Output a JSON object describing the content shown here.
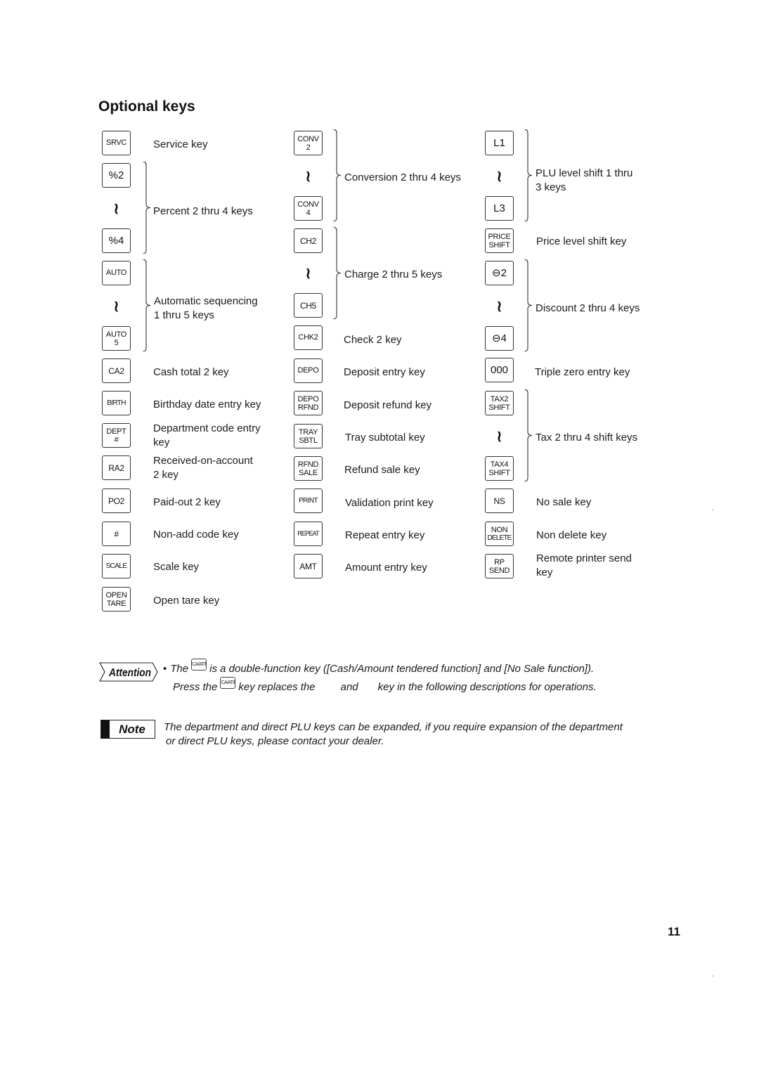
{
  "section_title": "Optional keys",
  "columns": [
    {
      "entries": [
        {
          "type": "single",
          "key": {
            "lines": [
              "SRVC"
            ]
          },
          "description": "Service key"
        },
        {
          "type": "range",
          "first": {
            "lines": [
              "%2"
            ]
          },
          "last": {
            "lines": [
              "%4"
            ]
          },
          "description": "Percent 2 thru 4 keys"
        },
        {
          "type": "range",
          "first": {
            "lines": [
              "AUTO"
            ]
          },
          "last": {
            "lines": [
              "AUTO",
              "5"
            ]
          },
          "description": [
            "Automatic sequencing",
            "1 thru 5 keys"
          ]
        },
        {
          "type": "single",
          "key": {
            "lines": [
              "CA2"
            ]
          },
          "description": "Cash total 2 key"
        },
        {
          "type": "single",
          "key": {
            "lines": [
              "BIRTH"
            ]
          },
          "description": "Birthday date entry key"
        },
        {
          "type": "single",
          "key": {
            "lines": [
              "DEPT",
              "#"
            ]
          },
          "description": [
            "Department code entry",
            "key"
          ]
        },
        {
          "type": "single",
          "key": {
            "lines": [
              "RA2"
            ]
          },
          "description": [
            "Received-on-account",
            "2 key"
          ]
        },
        {
          "type": "single",
          "key": {
            "lines": [
              "PO2"
            ]
          },
          "description": "Paid-out 2 key"
        },
        {
          "type": "single",
          "key": {
            "lines": [
              "#"
            ]
          },
          "description": "Non-add code key"
        },
        {
          "type": "single",
          "key": {
            "lines": [
              "SCALE"
            ]
          },
          "description": "Scale key"
        },
        {
          "type": "single",
          "key": {
            "lines": [
              "OPEN",
              "TARE"
            ]
          },
          "description": "Open tare key"
        }
      ]
    },
    {
      "entries": [
        {
          "type": "range",
          "first": {
            "lines": [
              "CONV",
              "2"
            ]
          },
          "last": {
            "lines": [
              "CONV",
              "4"
            ]
          },
          "description": "Conversion 2 thru 4 keys"
        },
        {
          "type": "range",
          "first": {
            "lines": [
              "CH2"
            ]
          },
          "last": {
            "lines": [
              "CH5"
            ]
          },
          "description": "Charge 2 thru 5 keys"
        },
        {
          "type": "single",
          "key": {
            "lines": [
              "CHK2"
            ]
          },
          "description": "Check 2 key"
        },
        {
          "type": "single",
          "key": {
            "lines": [
              "DEPO"
            ]
          },
          "description": "Deposit entry key"
        },
        {
          "type": "single",
          "key": {
            "lines": [
              "DEPO",
              "RFND"
            ]
          },
          "description": "Deposit refund key"
        },
        {
          "type": "single",
          "key": {
            "lines": [
              "TRAY",
              "SBTL"
            ]
          },
          "description": "Tray subtotal key"
        },
        {
          "type": "single",
          "key": {
            "lines": [
              "RFND",
              "SALE"
            ]
          },
          "description": "Refund sale key"
        },
        {
          "type": "single",
          "key": {
            "lines": [
              "PRINT"
            ]
          },
          "description": "Validation print key"
        },
        {
          "type": "single",
          "key": {
            "lines": [
              "REPEAT"
            ]
          },
          "description": "Repeat entry key"
        },
        {
          "type": "single",
          "key": {
            "lines": [
              "AMT"
            ]
          },
          "description": "Amount entry key"
        }
      ]
    },
    {
      "entries": [
        {
          "type": "range",
          "first": {
            "lines": [
              "L1"
            ]
          },
          "last": {
            "lines": [
              "L3"
            ]
          },
          "description": [
            "PLU level shift 1 thru",
            "3 keys"
          ]
        },
        {
          "type": "single",
          "key": {
            "lines": [
              "PRICE",
              "SHIFT"
            ]
          },
          "description": "Price level shift key"
        },
        {
          "type": "range",
          "first": {
            "lines": [
              "⊖2"
            ]
          },
          "last": {
            "lines": [
              "⊖4"
            ]
          },
          "description": "Discount 2 thru 4 keys"
        },
        {
          "type": "single",
          "key": {
            "lines": [
              "000"
            ]
          },
          "description": "Triple zero entry key"
        },
        {
          "type": "range",
          "first": {
            "lines": [
              "TAX2",
              "SHIFT"
            ]
          },
          "last": {
            "lines": [
              "TAX4",
              "SHIFT"
            ]
          },
          "description": "Tax 2 thru 4 shift keys"
        },
        {
          "type": "single",
          "key": {
            "lines": [
              "NS"
            ]
          },
          "description": "No sale key"
        },
        {
          "type": "single",
          "key": {
            "lines": [
              "NON",
              "DELETE"
            ]
          },
          "description": "Non delete key"
        },
        {
          "type": "single",
          "key": {
            "lines": [
              "RP",
              "SEND"
            ]
          },
          "description": [
            "Remote printer send",
            "key"
          ]
        }
      ]
    }
  ],
  "range_separator": "≀",
  "attention": {
    "badge_label": "Attention",
    "bullet": "•",
    "inline_key_label": "CA/AT/NS",
    "line1_before": "The",
    "line1_after": "is a double-function key ([Cash/Amount tendered function] and [No Sale function]).",
    "line2_before": "Press the",
    "line2_mid1": "key replaces the",
    "line2_mid2": "and",
    "line2_after": "key in the following descriptions for operations."
  },
  "note": {
    "badge_label": "Note",
    "line1": "The department and direct PLU keys can be expanded, if you require expansion of the department",
    "line2": "or direct PLU keys, please contact your dealer."
  },
  "page_number": "11"
}
